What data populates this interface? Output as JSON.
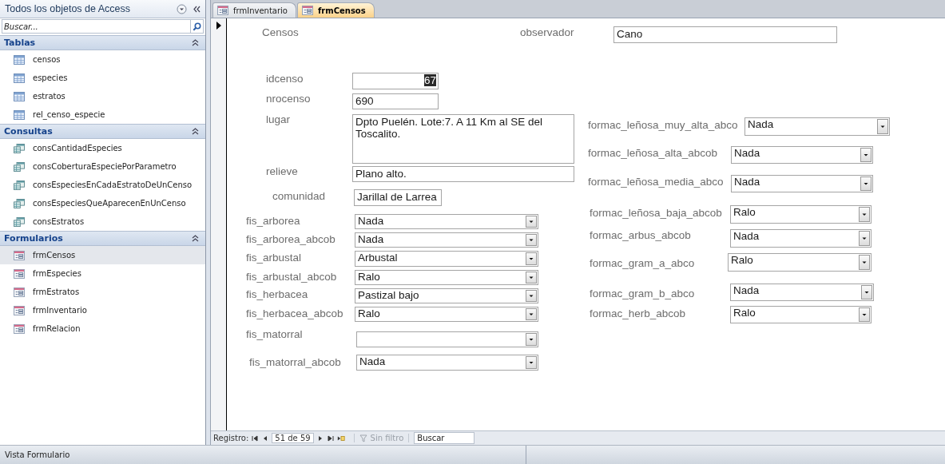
{
  "nav_pane": {
    "title": "Todos los objetos de Access",
    "search": {
      "placeholder": "Buscar..."
    },
    "groups": [
      {
        "label": "Tablas",
        "kind": "table",
        "expanded": true,
        "items": [
          {
            "label": "censos",
            "selected": false
          },
          {
            "label": "especies",
            "selected": false
          },
          {
            "label": "estratos",
            "selected": false
          },
          {
            "label": "rel_censo_especie",
            "selected": false
          }
        ]
      },
      {
        "label": "Consultas",
        "kind": "query",
        "expanded": true,
        "items": [
          {
            "label": "consCantidadEspecies",
            "selected": false
          },
          {
            "label": "consCoberturaEspeciePorParametro",
            "selected": false
          },
          {
            "label": "consEspeciesEnCadaEstratoDeUnCenso",
            "selected": false
          },
          {
            "label": "consEspeciesQueAparecenEnUnCenso",
            "selected": false
          },
          {
            "label": "consEstratos",
            "selected": false
          }
        ]
      },
      {
        "label": "Formularios",
        "kind": "form",
        "expanded": true,
        "items": [
          {
            "label": "frmCensos",
            "selected": true
          },
          {
            "label": "frmEspecies",
            "selected": false
          },
          {
            "label": "frmEstratos",
            "selected": false
          },
          {
            "label": "frmInventario",
            "selected": false
          },
          {
            "label": "frmRelacion",
            "selected": false
          }
        ]
      }
    ]
  },
  "tabs": [
    {
      "label": "frmInventario",
      "selected": false
    },
    {
      "label": "frmCensos",
      "selected": true
    }
  ],
  "form": {
    "title": "Censos",
    "controls": [
      {
        "kind": "text",
        "label": "observador",
        "value": "Cano",
        "focused": false
      },
      {
        "kind": "text",
        "label": "idcenso",
        "value": "67",
        "focused": true
      },
      {
        "kind": "text",
        "label": "nrocenso",
        "value": "690",
        "focused": false
      },
      {
        "kind": "memo",
        "label": "lugar",
        "value": "Dpto Puelén. Lote:7. A 11 Km al SE del Toscalito.",
        "focused": false
      },
      {
        "kind": "text",
        "label": "relieve",
        "value": "Plano alto.",
        "focused": false
      },
      {
        "kind": "text",
        "label": "comunidad",
        "value": "Jarillal de Larrea",
        "focused": false
      },
      {
        "kind": "combo",
        "label": "fis_arborea",
        "value": "Nada"
      },
      {
        "kind": "combo",
        "label": "fis_arborea_abcob",
        "value": "Nada"
      },
      {
        "kind": "combo",
        "label": "fis_arbustal",
        "value": "Arbustal"
      },
      {
        "kind": "combo",
        "label": "fis_arbustal_abcob",
        "value": "Ralo"
      },
      {
        "kind": "combo",
        "label": "fis_herbacea",
        "value": "Pastizal bajo"
      },
      {
        "kind": "combo",
        "label": "fis_herbacea_abcob",
        "value": "Ralo"
      },
      {
        "kind": "combo",
        "label": "fis_matorral"
      },
      {
        "kind": "combo",
        "label": "fis_matorral_abcob",
        "value": "Nada"
      },
      {
        "kind": "combo",
        "label": "formac_leñosa_muy_alta_abco",
        "value": "Nada"
      },
      {
        "kind": "combo",
        "label": "formac_leñosa_alta_abcob",
        "value": "Nada"
      },
      {
        "kind": "combo",
        "label": "formac_leñosa_media_abco",
        "value": "Nada"
      },
      {
        "kind": "combo",
        "label": "formac_leñosa_baja_abcob",
        "value": "Ralo"
      },
      {
        "kind": "combo",
        "label": "formac_arbus_abcob",
        "value": "Nada"
      },
      {
        "kind": "combo",
        "label": "formac_gram_a_abco",
        "value": "Ralo"
      },
      {
        "kind": "combo",
        "label": "formac_gram_b_abco",
        "value": "Nada"
      },
      {
        "kind": "combo",
        "label": "formac_herb_abcob",
        "value": "Ralo"
      }
    ]
  },
  "record_nav": {
    "label": "Registro:",
    "position": "51 de 59",
    "filter": {
      "label": "Sin filtro",
      "disabled": true
    },
    "search": {
      "placeholder": "Buscar"
    }
  },
  "status_bar": {
    "text": "Vista Formulario"
  }
}
